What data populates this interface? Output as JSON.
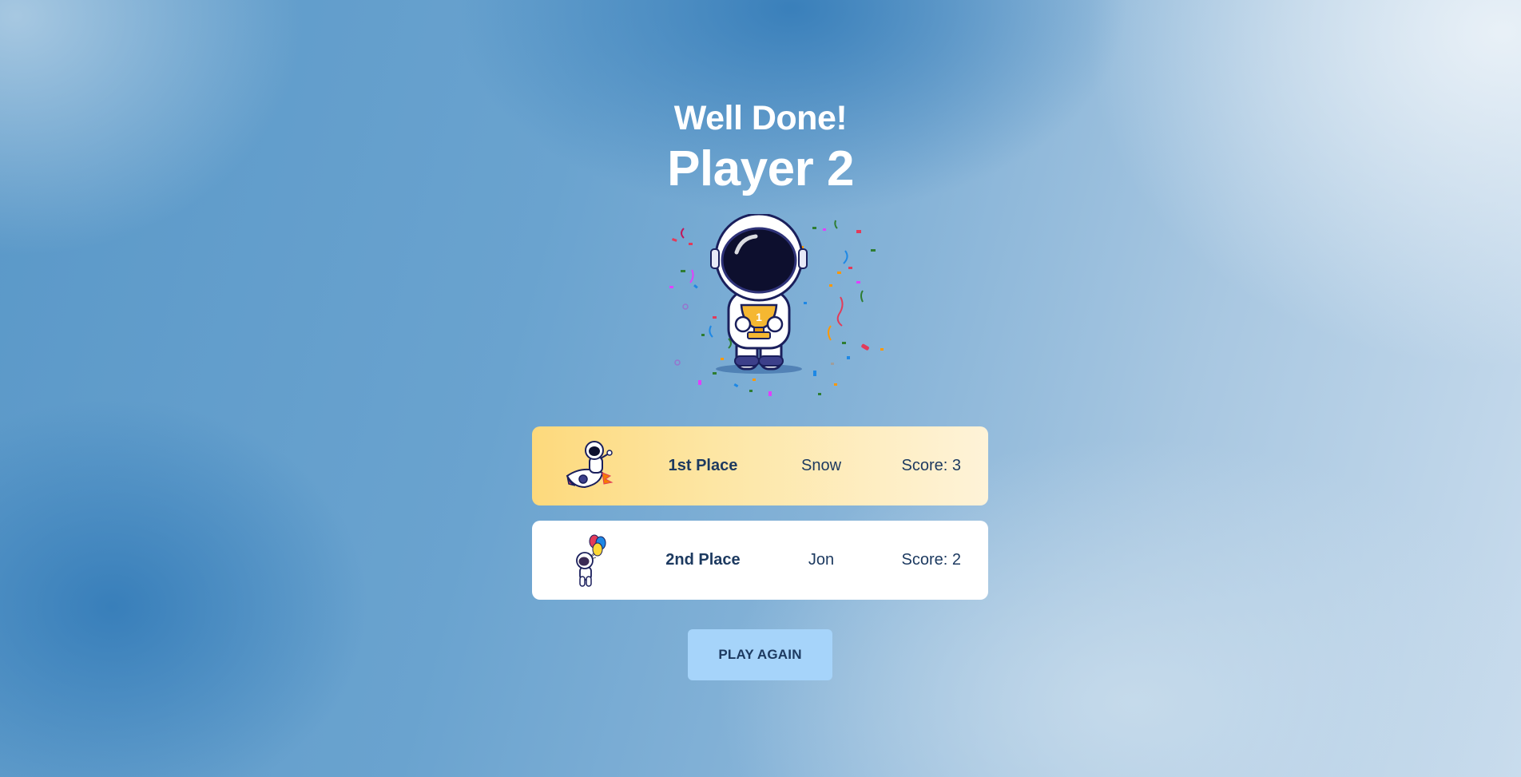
{
  "result": {
    "headline": "Well Done!",
    "winner": "Player 2"
  },
  "leaderboard": [
    {
      "place": "1st Place",
      "name": "Snow",
      "score": "Score: 3",
      "avatar_icon": "astronaut-on-rocket-icon",
      "highlight_color": "#fdd97c"
    },
    {
      "place": "2nd Place",
      "name": "Jon",
      "score": "Score: 2",
      "avatar_icon": "astronaut-with-balloons-icon",
      "highlight_color": "#ffffff"
    }
  ],
  "actions": {
    "play_again_label": "PLAY AGAIN"
  },
  "colors": {
    "text_dark": "#1d3a60",
    "button_bg": "#a6d4fa",
    "background_blue": "#5a98c8"
  },
  "hero_icon": "astronaut-with-trophy-icon"
}
